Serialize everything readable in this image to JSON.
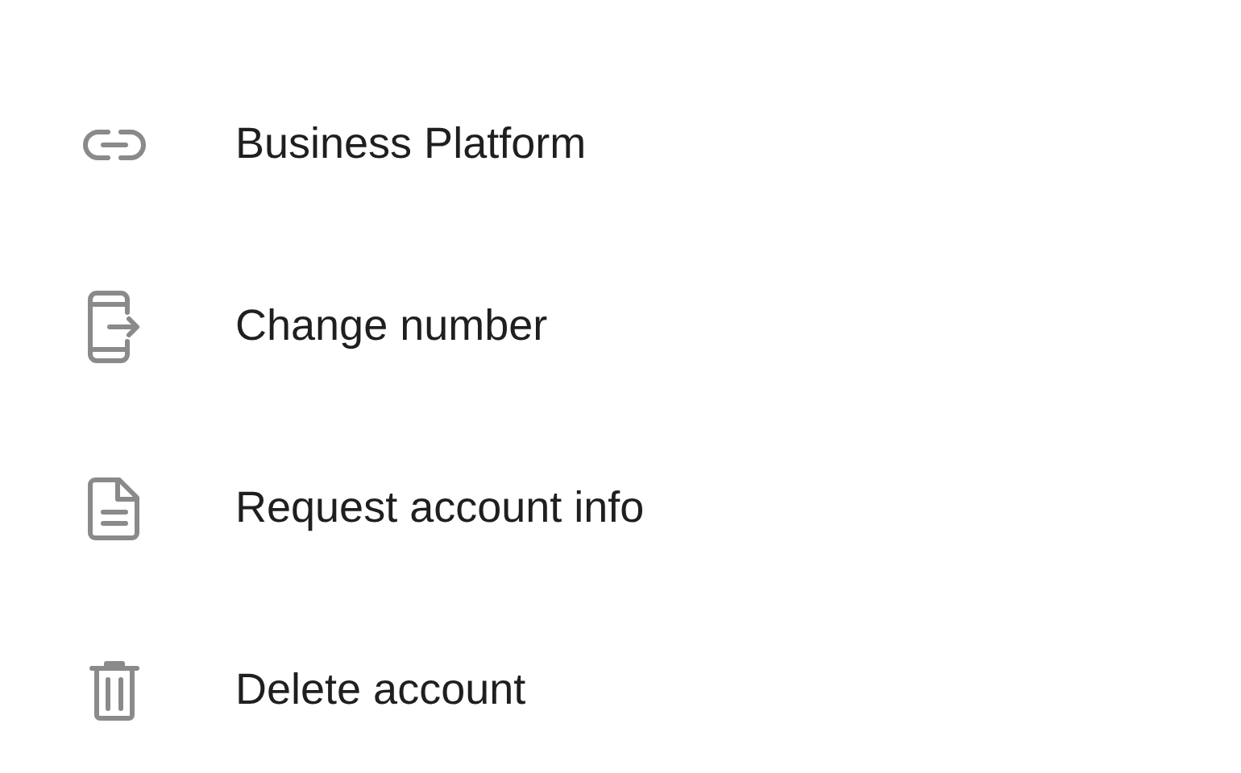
{
  "menu_items": [
    {
      "kind": "link",
      "label": "Business Platform"
    },
    {
      "kind": "phone",
      "label": "Change number"
    },
    {
      "kind": "document",
      "label": "Request account info"
    },
    {
      "kind": "trash",
      "label": "Delete account"
    }
  ]
}
